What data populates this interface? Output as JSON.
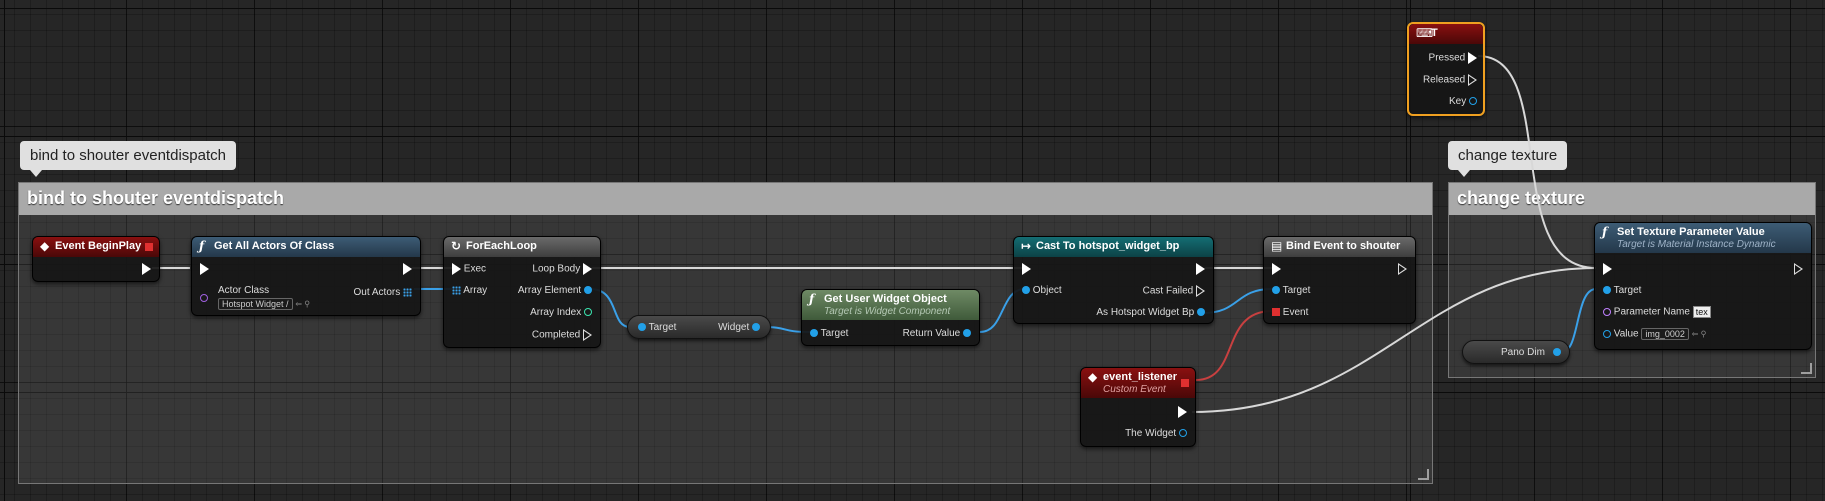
{
  "comments": [
    {
      "bubble": "bind to shouter eventdispatch",
      "title": "bind to shouter eventdispatch"
    },
    {
      "bubble": "change texture",
      "title": "change texture"
    }
  ],
  "nodes": {
    "begin_play": {
      "title": "Event BeginPlay"
    },
    "get_all_actors": {
      "title": "Get All Actors Of Class",
      "actor_class_label": "Actor Class",
      "actor_class_value": "Hotspot Widget /",
      "out_actors": "Out Actors"
    },
    "foreach": {
      "title": "ForEachLoop",
      "exec": "Exec",
      "array": "Array",
      "loop_body": "Loop Body",
      "array_element": "Array Element",
      "array_index": "Array Index",
      "completed": "Completed"
    },
    "target_widget": {
      "target": "Target",
      "widget": "Widget"
    },
    "get_user_widget": {
      "title": "Get User Widget Object",
      "subtitle": "Target is Widget Component",
      "target": "Target",
      "return_value": "Return Value"
    },
    "cast": {
      "title": "Cast To hotspot_widget_bp",
      "object": "Object",
      "cast_failed": "Cast Failed",
      "as_hotspot": "As Hotspot Widget Bp"
    },
    "bind_event": {
      "title": "Bind Event to shouter",
      "target": "Target",
      "event": "Event"
    },
    "event_listener": {
      "title": "event_listener",
      "subtitle": "Custom Event",
      "the_widget": "The Widget"
    },
    "key_t": {
      "title": "T",
      "pressed": "Pressed",
      "released": "Released",
      "key": "Key"
    },
    "pano_dim": {
      "label": "Pano Dim"
    },
    "set_texture": {
      "title": "Set Texture Parameter Value",
      "subtitle": "Target is Material Instance Dynamic",
      "target": "Target",
      "param_name_label": "Parameter Name",
      "param_name_value": "tex",
      "value_label": "Value",
      "value_value": "img_0002"
    }
  },
  "colors": {
    "exec": "#ffffff",
    "object": "#22a0e8",
    "event": "#e03030",
    "name": "#c080ff",
    "wire_exec": "#d8d8d8",
    "wire_red": "#c84040"
  },
  "icons": {
    "function": "function-icon",
    "event": "event-diamond-icon",
    "loop": "loop-icon",
    "cast": "cast-arrow-icon",
    "bind": "bind-event-icon",
    "keyboard": "keyboard-icon"
  }
}
